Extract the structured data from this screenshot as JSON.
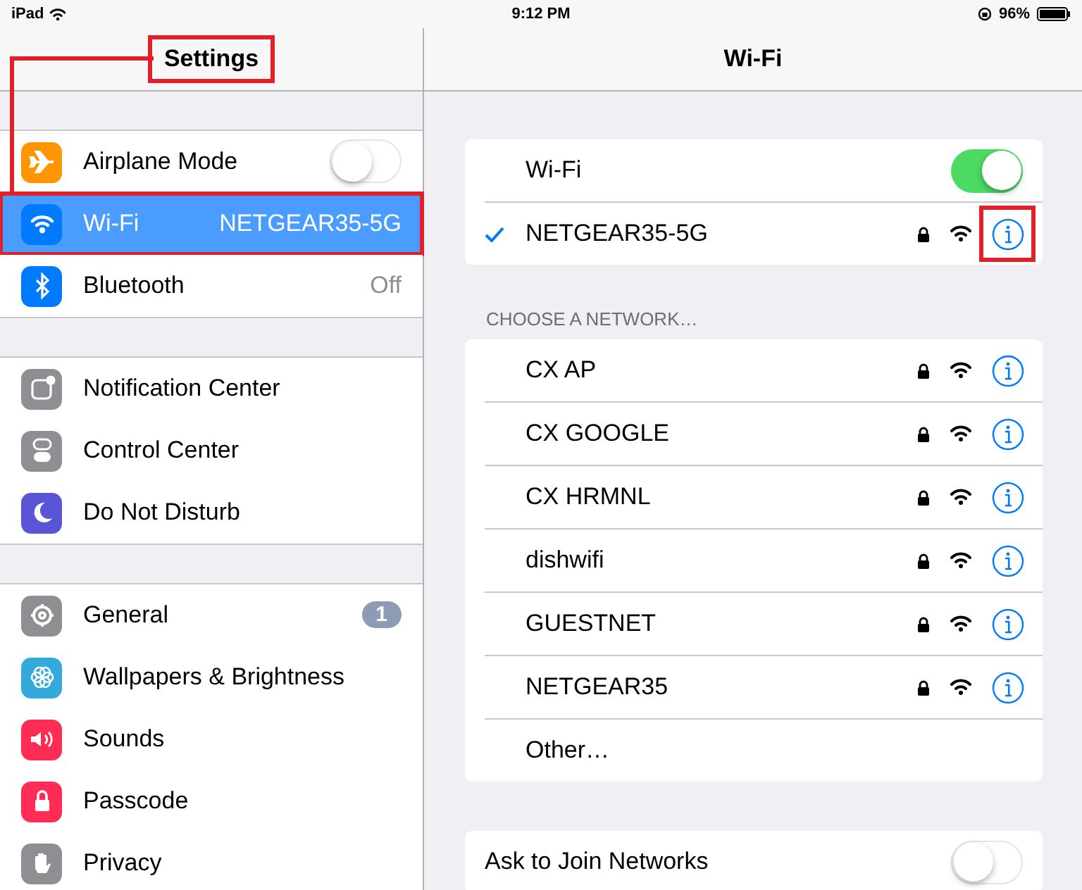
{
  "status_bar": {
    "device": "iPad",
    "time": "9:12 PM",
    "battery": "96%"
  },
  "sidebar": {
    "title": "Settings",
    "title_highlighted": true,
    "groups": [
      {
        "items": [
          {
            "label": "Airplane Mode",
            "color": "#ff9500",
            "toggle": {
              "on": false
            },
            "selected": false,
            "highlighted": false
          },
          {
            "label": "Wi-Fi",
            "value": "NETGEAR35-5G",
            "color": "#007aff",
            "selected": true,
            "highlighted": true
          },
          {
            "label": "Bluetooth",
            "value": "Off",
            "color": "#007aff",
            "selected": false,
            "highlighted": false
          }
        ]
      },
      {
        "items": [
          {
            "label": "Notification Center",
            "color": "#8e8e93",
            "selected": false,
            "highlighted": false
          },
          {
            "label": "Control Center",
            "color": "#8e8e93",
            "selected": false,
            "highlighted": false
          },
          {
            "label": "Do Not Disturb",
            "color": "#5856d6",
            "selected": false,
            "highlighted": false
          }
        ]
      },
      {
        "items": [
          {
            "label": "General",
            "badge": "1",
            "color": "#8e8e93",
            "selected": false,
            "highlighted": false
          },
          {
            "label": "Wallpapers & Brightness",
            "color": "#34aadc",
            "selected": false,
            "highlighted": false
          },
          {
            "label": "Sounds",
            "color": "#ff2d55",
            "selected": false,
            "highlighted": false
          },
          {
            "label": "Passcode",
            "color": "#ff2d55",
            "selected": false,
            "highlighted": false
          },
          {
            "label": "Privacy",
            "color": "#8e8e93",
            "selected": false,
            "highlighted": false
          }
        ]
      }
    ]
  },
  "detail": {
    "title": "Wi-Fi",
    "wifi_toggle": {
      "label": "Wi-Fi",
      "on": true
    },
    "connected": {
      "name": "NETGEAR35-5G",
      "checked": true,
      "locked": true,
      "info_highlighted": true
    },
    "section_header": "CHOOSE A NETWORK…",
    "networks": [
      {
        "name": "CX AP",
        "locked": true
      },
      {
        "name": "CX GOOGLE",
        "locked": true
      },
      {
        "name": "CX HRMNL",
        "locked": true
      },
      {
        "name": "dishwifi",
        "locked": true
      },
      {
        "name": "GUESTNET",
        "locked": true
      },
      {
        "name": "NETGEAR35",
        "locked": true
      }
    ],
    "other": "Other…",
    "ask_to_join": {
      "label": "Ask to Join Networks",
      "on": false
    }
  }
}
